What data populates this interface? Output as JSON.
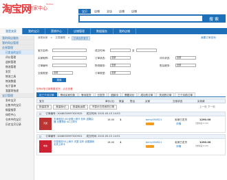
{
  "header": {
    "brand": "淘宝网",
    "subtitle": "卖家中心",
    "brand_sup": "Taobao",
    "search_tabs": [
      "宝贝",
      "店铺",
      "全店",
      "店铺",
      "店铺"
    ],
    "search_placeholder": "",
    "search_button": "搜索"
  },
  "topnav": [
    "我是卖家",
    "我的宝贝",
    "营销中心",
    "店铺管理",
    "数据服务",
    "我的店铺"
  ],
  "sidebar": {
    "sections": [
      {
        "head": "我的网店服务",
        "items": []
      },
      {
        "head": "我的网店管理",
        "items": []
      },
      {
        "head": "交易管理",
        "items": [
          "已卖出的宝贝",
          "评价管理",
          "退款管理",
          "物流管理",
          "发货",
          "物流工具",
          "物流数据",
          "电子面单",
          "我要寄快递"
        ]
      },
      {
        "head": "宝贝管理",
        "items": [
          "发布宝贝",
          "出售中的宝贝",
          "橱窗推荐",
          "体检中心",
          "仓库中的宝贝",
          "历史宝贝记录"
        ]
      }
    ]
  },
  "breadcrumb": [
    "我是卖家",
    "交易管理",
    "已卖出的宝贝"
  ],
  "breadcrumb_right": "我要订单查询",
  "filters": {
    "labels": [
      "宝贝名称:",
      "成交时间:",
      "至",
      "买家昵称:",
      "订单状态:",
      "评价状态:",
      "订单编号:",
      "物流服务:",
      "售后服务:",
      "交易类型:",
      "订单类型:"
    ],
    "values": [
      "",
      "",
      "",
      "全部",
      "全部",
      "全部",
      "全部",
      "全部",
      "全部"
    ],
    "search_button": "搜索"
  },
  "tip": "您有6笔订单需要发货，点击查看",
  "status_tabs": [
    "近三个月订单",
    "等待买家付款",
    "等待发货",
    "已发货",
    "退款中",
    "需要评价",
    "成功的订单",
    "关闭的订单",
    "三个月前订单"
  ],
  "table_head": [
    "宝贝",
    "单价(元)",
    "数量",
    "售后",
    "买家",
    "交易状态",
    "实收款"
  ],
  "batch_buttons": [
    "批量发货",
    "批量标记",
    "批量免运费",
    "不显示已关闭的订单"
  ],
  "pager": "上一页 下一页",
  "orders": [
    {
      "number": "订单编号: 1048035997020925",
      "time": "成交时间: 2015-05-15 14:53",
      "title": "天津电信3.6G全国上网卡 包年 送路由器 无需预存 4G上网卡",
      "price": "18.00",
      "qty": "1",
      "buyer": "berry050821",
      "status": "卖家已发货",
      "action": "详情",
      "total": "1290.00",
      "total_sub": "(含快递:0.00)"
    },
    {
      "number": "订单编号: 1048035597020921",
      "time": "成交时间: 2015-05-15 14:51",
      "title": "中国电信3G上网卡 天翼 包年 全国通用 无线上网卡",
      "price": "18.00",
      "qty": "1",
      "buyer": "berry050821",
      "status": "卖家已发货",
      "action": "详情",
      "total": "1290.00",
      "total_sub": "(含快递:0.00)"
    }
  ],
  "colors": {
    "accent": "#1d6fb8",
    "brand": "#e4393c"
  }
}
